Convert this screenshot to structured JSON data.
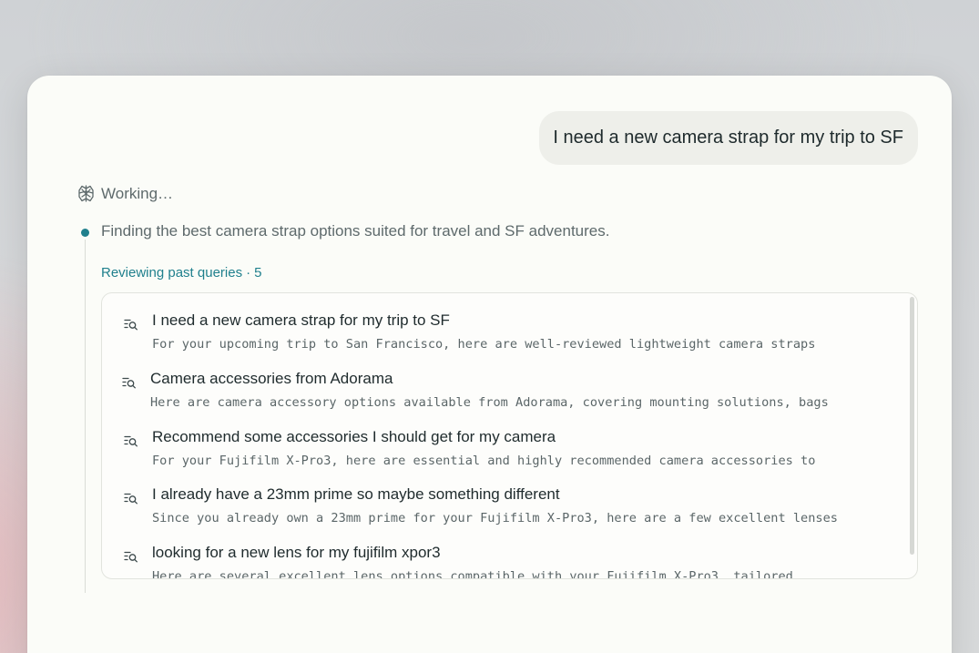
{
  "conversation": {
    "user_message": "I need a new camera strap for my trip to SF"
  },
  "status": {
    "label": "Working…",
    "icon": "sparkle-brain-icon"
  },
  "step": {
    "text": "Finding the best camera strap options suited for travel and SF adventures.",
    "reviewing_label": "Reviewing past queries",
    "separator": "·",
    "count": "5",
    "accent_color": "#20808d"
  },
  "queries": [
    {
      "title": "I need a new camera strap for my trip to SF",
      "snippet": "For your upcoming trip to San Francisco, here are well-reviewed lightweight camera straps",
      "icon": "search-list-icon"
    },
    {
      "title": "Camera accessories from Adorama",
      "snippet": "Here are camera accessory options available from Adorama, covering mounting solutions, bags",
      "icon": "search-list-icon"
    },
    {
      "title": "Recommend some accessories I should get for my camera",
      "snippet": "For your Fujifilm X-Pro3, here are essential and highly recommended camera accessories to",
      "icon": "search-list-icon"
    },
    {
      "title": "I already have a 23mm prime so maybe something different",
      "snippet": "Since you already own a 23mm prime for your Fujifilm X-Pro3, here are a few excellent lenses",
      "icon": "search-list-icon"
    },
    {
      "title": "looking for a new lens for my fujifilm xpor3",
      "snippet": "Here are several excellent lens options compatible with your Fujifilm X-Pro3, tailored",
      "icon": "search-list-icon"
    }
  ]
}
